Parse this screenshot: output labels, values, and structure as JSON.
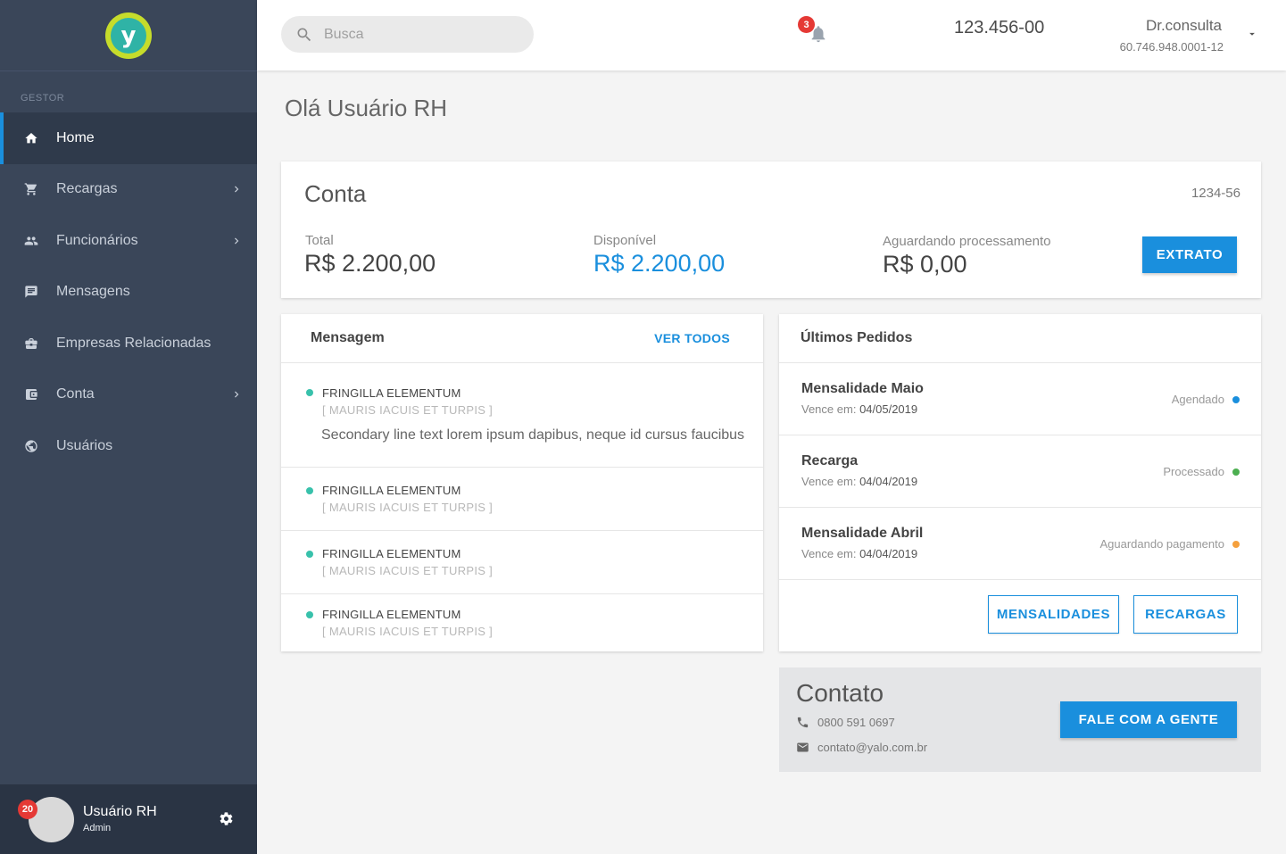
{
  "sidebar": {
    "logo_letter": "y",
    "section_label": "GESTOR",
    "items": [
      {
        "label": "Home",
        "icon": "home-icon",
        "active": true,
        "has_chevron": false
      },
      {
        "label": "Recargas",
        "icon": "cart-icon",
        "active": false,
        "has_chevron": true
      },
      {
        "label": "Funcionários",
        "icon": "people-icon",
        "active": false,
        "has_chevron": true
      },
      {
        "label": "Mensagens",
        "icon": "message-icon",
        "active": false,
        "has_chevron": false
      },
      {
        "label": "Empresas Relacionadas",
        "icon": "briefcase-icon",
        "active": false,
        "has_chevron": false
      },
      {
        "label": "Conta",
        "icon": "wallet-icon",
        "active": false,
        "has_chevron": true
      },
      {
        "label": "Usuários",
        "icon": "globe-icon",
        "active": false,
        "has_chevron": false
      }
    ],
    "user": {
      "name": "Usuário RH",
      "role": "Admin",
      "badge": "20"
    }
  },
  "topbar": {
    "search_placeholder": "Busca",
    "notification_count": "3",
    "account_number": "123.456-00",
    "company_name": "Dr.consulta",
    "company_cnpj": "60.746.948.0001-12"
  },
  "greeting": "Olá Usuário RH",
  "account": {
    "title": "Conta",
    "code": "1234-56",
    "total_label": "Total",
    "total_value": "R$ 2.200,00",
    "available_label": "Disponível",
    "available_value": "R$ 2.200,00",
    "pending_label": "Aguardando processamento",
    "pending_value": "R$ 0,00",
    "extrato_label": "EXTRATO"
  },
  "messages": {
    "title": "Mensagem",
    "see_all": "VER TODOS",
    "items": [
      {
        "title": "FRINGILLA ELEMENTUM",
        "subtitle": "[ MAURIS IACUIS ET TURPIS ]",
        "body": "Secondary line text lorem ipsum dapibus, neque id cursus faucibus"
      },
      {
        "title": "FRINGILLA ELEMENTUM",
        "subtitle": "[ MAURIS IACUIS ET TURPIS ]"
      },
      {
        "title": "FRINGILLA ELEMENTUM",
        "subtitle": "[ MAURIS IACUIS ET TURPIS ]"
      },
      {
        "title": "FRINGILLA ELEMENTUM",
        "subtitle": "[ MAURIS IACUIS ET TURPIS ]"
      }
    ]
  },
  "orders": {
    "title": "Últimos Pedidos",
    "due_label": "Vence em:",
    "items": [
      {
        "title": "Mensalidade Maio",
        "due": "04/05/2019",
        "status": "Agendado",
        "status_color": "#1a8fdd"
      },
      {
        "title": "Recarga",
        "due": "04/04/2019",
        "status": "Processado",
        "status_color": "#4caf50"
      },
      {
        "title": "Mensalidade Abril",
        "due": "04/04/2019",
        "status": "Aguardando pagamento",
        "status_color": "#f5a03d"
      }
    ],
    "btn_mensalidades": "MENSALIDADES",
    "btn_recargas": "RECARGAS"
  },
  "contact": {
    "title": "Contato",
    "phone": "0800 591 0697",
    "email": "contato@yalo.com.br",
    "button": "FALE COM A GENTE"
  },
  "colors": {
    "primary": "#1a8fdd",
    "sidebar": "#3a4659",
    "message_dot": "#38c1ab",
    "badge": "#e53935"
  }
}
